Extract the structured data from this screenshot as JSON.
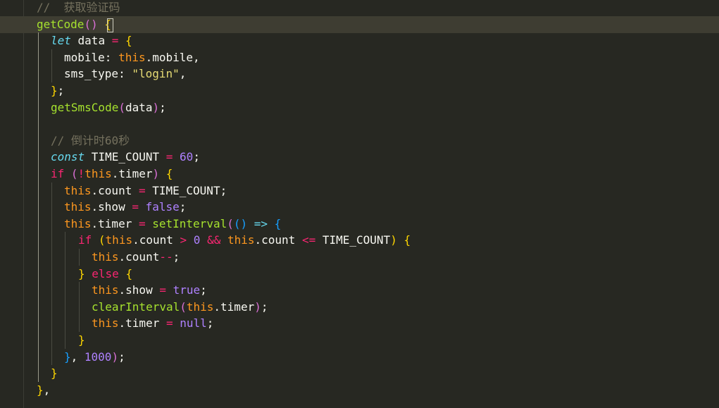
{
  "editor": {
    "theme_colors": {
      "background": "#272822",
      "current_line": "#3e3d32",
      "comment": "#75715e",
      "function": "#a6e22e",
      "keyword": "#f92672",
      "this": "#fd971f",
      "string": "#e6db74",
      "number": "#ae81ff",
      "declaration": "#66d9ef"
    },
    "lines": [
      {
        "indent": 1,
        "tokens": [
          {
            "t": "//  获取验证码",
            "c": "comment"
          }
        ]
      },
      {
        "indent": 1,
        "current": true,
        "tokens": [
          {
            "t": "getCode",
            "c": "fn"
          },
          {
            "t": "() ",
            "c": "brace-p"
          },
          {
            "t": "{",
            "c": "brace-y"
          }
        ]
      },
      {
        "indent": 2,
        "tokens": [
          {
            "t": "let",
            "c": "decl"
          },
          {
            "t": " data ",
            "c": "plain"
          },
          {
            "t": "=",
            "c": "op"
          },
          {
            "t": " ",
            "c": "plain"
          },
          {
            "t": "{",
            "c": "brace-y"
          }
        ]
      },
      {
        "indent": 3,
        "tokens": [
          {
            "t": "mobile: ",
            "c": "plain"
          },
          {
            "t": "this",
            "c": "this"
          },
          {
            "t": ".mobile,",
            "c": "plain"
          }
        ]
      },
      {
        "indent": 3,
        "tokens": [
          {
            "t": "sms_type: ",
            "c": "plain"
          },
          {
            "t": "\"login\"",
            "c": "str"
          },
          {
            "t": ",",
            "c": "plain"
          }
        ]
      },
      {
        "indent": 2,
        "tokens": [
          {
            "t": "}",
            "c": "brace-y"
          },
          {
            "t": ";",
            "c": "plain"
          }
        ]
      },
      {
        "indent": 2,
        "tokens": [
          {
            "t": "getSmsCode",
            "c": "fn"
          },
          {
            "t": "(",
            "c": "brace-p"
          },
          {
            "t": "data",
            "c": "plain"
          },
          {
            "t": ")",
            "c": "brace-p"
          },
          {
            "t": ";",
            "c": "plain"
          }
        ]
      },
      {
        "indent": 0,
        "tokens": []
      },
      {
        "indent": 2,
        "tokens": [
          {
            "t": "// 倒计时60秒",
            "c": "comment"
          }
        ]
      },
      {
        "indent": 2,
        "tokens": [
          {
            "t": "const",
            "c": "decl"
          },
          {
            "t": " TIME_COUNT ",
            "c": "plain"
          },
          {
            "t": "=",
            "c": "op"
          },
          {
            "t": " ",
            "c": "plain"
          },
          {
            "t": "60",
            "c": "num"
          },
          {
            "t": ";",
            "c": "plain"
          }
        ]
      },
      {
        "indent": 2,
        "tokens": [
          {
            "t": "if",
            "c": "kw"
          },
          {
            "t": " ",
            "c": "plain"
          },
          {
            "t": "(",
            "c": "brace-p"
          },
          {
            "t": "!",
            "c": "op"
          },
          {
            "t": "this",
            "c": "this"
          },
          {
            "t": ".timer",
            "c": "plain"
          },
          {
            "t": ")",
            "c": "brace-p"
          },
          {
            "t": " ",
            "c": "plain"
          },
          {
            "t": "{",
            "c": "brace-y"
          }
        ]
      },
      {
        "indent": 3,
        "tokens": [
          {
            "t": "this",
            "c": "this"
          },
          {
            "t": ".count ",
            "c": "plain"
          },
          {
            "t": "=",
            "c": "op"
          },
          {
            "t": " TIME_COUNT;",
            "c": "plain"
          }
        ]
      },
      {
        "indent": 3,
        "tokens": [
          {
            "t": "this",
            "c": "this"
          },
          {
            "t": ".show ",
            "c": "plain"
          },
          {
            "t": "=",
            "c": "op"
          },
          {
            "t": " ",
            "c": "plain"
          },
          {
            "t": "false",
            "c": "const"
          },
          {
            "t": ";",
            "c": "plain"
          }
        ]
      },
      {
        "indent": 3,
        "tokens": [
          {
            "t": "this",
            "c": "this"
          },
          {
            "t": ".timer ",
            "c": "plain"
          },
          {
            "t": "=",
            "c": "op"
          },
          {
            "t": " ",
            "c": "plain"
          },
          {
            "t": "setInterval",
            "c": "fn"
          },
          {
            "t": "(",
            "c": "brace-p"
          },
          {
            "t": "()",
            "c": "brace-b"
          },
          {
            "t": " ",
            "c": "plain"
          },
          {
            "t": "=>",
            "c": "decl"
          },
          {
            "t": " ",
            "c": "plain"
          },
          {
            "t": "{",
            "c": "brace-b"
          }
        ]
      },
      {
        "indent": 4,
        "tokens": [
          {
            "t": "if",
            "c": "kw"
          },
          {
            "t": " ",
            "c": "plain"
          },
          {
            "t": "(",
            "c": "brace-y"
          },
          {
            "t": "this",
            "c": "this"
          },
          {
            "t": ".count ",
            "c": "plain"
          },
          {
            "t": ">",
            "c": "op"
          },
          {
            "t": " ",
            "c": "plain"
          },
          {
            "t": "0",
            "c": "num"
          },
          {
            "t": " ",
            "c": "plain"
          },
          {
            "t": "&&",
            "c": "op"
          },
          {
            "t": " ",
            "c": "plain"
          },
          {
            "t": "this",
            "c": "this"
          },
          {
            "t": ".count ",
            "c": "plain"
          },
          {
            "t": "<=",
            "c": "op"
          },
          {
            "t": " TIME_COUNT",
            "c": "plain"
          },
          {
            "t": ")",
            "c": "brace-y"
          },
          {
            "t": " ",
            "c": "plain"
          },
          {
            "t": "{",
            "c": "brace-y"
          }
        ]
      },
      {
        "indent": 5,
        "tokens": [
          {
            "t": "this",
            "c": "this"
          },
          {
            "t": ".count",
            "c": "plain"
          },
          {
            "t": "--",
            "c": "op"
          },
          {
            "t": ";",
            "c": "plain"
          }
        ]
      },
      {
        "indent": 4,
        "tokens": [
          {
            "t": "}",
            "c": "brace-y"
          },
          {
            "t": " ",
            "c": "plain"
          },
          {
            "t": "else",
            "c": "kw"
          },
          {
            "t": " ",
            "c": "plain"
          },
          {
            "t": "{",
            "c": "brace-y"
          }
        ]
      },
      {
        "indent": 5,
        "tokens": [
          {
            "t": "this",
            "c": "this"
          },
          {
            "t": ".show ",
            "c": "plain"
          },
          {
            "t": "=",
            "c": "op"
          },
          {
            "t": " ",
            "c": "plain"
          },
          {
            "t": "true",
            "c": "const"
          },
          {
            "t": ";",
            "c": "plain"
          }
        ]
      },
      {
        "indent": 5,
        "tokens": [
          {
            "t": "clearInterval",
            "c": "fn"
          },
          {
            "t": "(",
            "c": "brace-p"
          },
          {
            "t": "this",
            "c": "this"
          },
          {
            "t": ".timer",
            "c": "plain"
          },
          {
            "t": ")",
            "c": "brace-p"
          },
          {
            "t": ";",
            "c": "plain"
          }
        ]
      },
      {
        "indent": 5,
        "tokens": [
          {
            "t": "this",
            "c": "this"
          },
          {
            "t": ".timer ",
            "c": "plain"
          },
          {
            "t": "=",
            "c": "op"
          },
          {
            "t": " ",
            "c": "plain"
          },
          {
            "t": "null",
            "c": "const"
          },
          {
            "t": ";",
            "c": "plain"
          }
        ]
      },
      {
        "indent": 4,
        "tokens": [
          {
            "t": "}",
            "c": "brace-y"
          }
        ]
      },
      {
        "indent": 3,
        "tokens": [
          {
            "t": "}",
            "c": "brace-b"
          },
          {
            "t": ", ",
            "c": "plain"
          },
          {
            "t": "1000",
            "c": "num"
          },
          {
            "t": ")",
            "c": "brace-p"
          },
          {
            "t": ";",
            "c": "plain"
          }
        ]
      },
      {
        "indent": 2,
        "tokens": [
          {
            "t": "}",
            "c": "brace-y"
          }
        ]
      },
      {
        "indent": 1,
        "tokens": [
          {
            "t": "}",
            "c": "brace-y"
          },
          {
            "t": ",",
            "c": "plain"
          }
        ]
      }
    ]
  }
}
